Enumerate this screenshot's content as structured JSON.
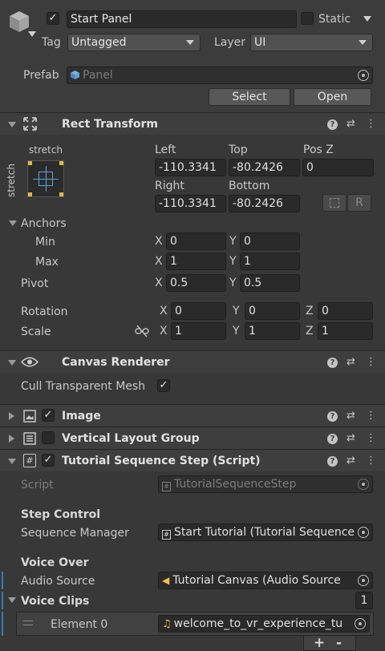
{
  "gameobject": {
    "name": "Start Panel",
    "active": true,
    "static_label": "Static",
    "tag_label": "Tag",
    "tag_value": "Untagged",
    "layer_label": "Layer",
    "layer_value": "UI",
    "prefab_label": "Prefab",
    "prefab_value": "Panel",
    "select_button": "Select",
    "open_button": "Open"
  },
  "rect_transform": {
    "title": "Rect Transform",
    "stretch_top": "stretch",
    "stretch_side": "stretch",
    "left_label": "Left",
    "left_value": "-110.3341",
    "top_label": "Top",
    "top_value": "-80.2426",
    "posz_label": "Pos Z",
    "posz_value": "0",
    "right_label": "Right",
    "right_value": "-110.3341",
    "bottom_label": "Bottom",
    "bottom_value": "-80.2426",
    "raw_button": "R",
    "anchors_label": "Anchors",
    "min_label": "Min",
    "min_x": "0",
    "min_y": "0",
    "max_label": "Max",
    "max_x": "1",
    "max_y": "1",
    "pivot_label": "Pivot",
    "pivot_x": "0.5",
    "pivot_y": "0.5",
    "rotation_label": "Rotation",
    "rot_x": "0",
    "rot_y": "0",
    "rot_z": "0",
    "scale_label": "Scale",
    "scale_x": "1",
    "scale_y": "1",
    "scale_z": "1",
    "axis_x": "X",
    "axis_y": "Y",
    "axis_z": "Z"
  },
  "canvas_renderer": {
    "title": "Canvas Renderer",
    "cull_label": "Cull Transparent Mesh",
    "cull_checked": true
  },
  "image": {
    "title": "Image",
    "enabled": true
  },
  "vertical_layout": {
    "title": "Vertical Layout Group",
    "enabled": false
  },
  "tutorial_step": {
    "title": "Tutorial Sequence Step (Script)",
    "enabled": true,
    "script_label": "Script",
    "script_value": "TutorialSequenceStep",
    "step_control_header": "Step Control",
    "sequence_manager_label": "Sequence Manager",
    "sequence_manager_value": "Start Tutorial (Tutorial Sequence",
    "voice_over_header": "Voice Over",
    "audio_source_label": "Audio Source",
    "audio_source_value": "Tutorial Canvas  (Audio Source",
    "voice_clips_label": "Voice Clips",
    "voice_clips_count": "1",
    "element0_label": "Element 0",
    "element0_value": "welcome_to_vr_experience_tu"
  },
  "list_controls": {
    "add": "+",
    "remove": "-"
  },
  "colors": {
    "panel_bg": "#383838",
    "header_bg": "#3e3e3e",
    "field_bg": "#2a2a2a",
    "accent_blue": "#3a79bb",
    "audio_yellow": "#f2c14a"
  }
}
